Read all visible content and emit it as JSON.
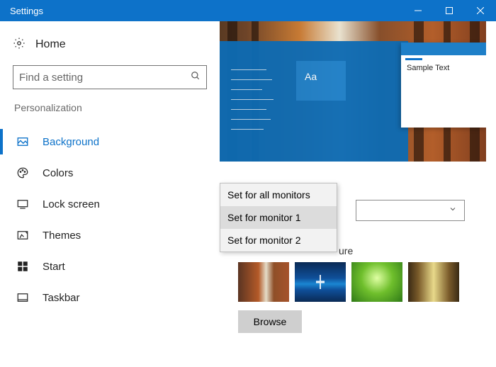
{
  "titlebar": {
    "title": "Settings"
  },
  "sidebar": {
    "home_label": "Home",
    "search_placeholder": "Find a setting",
    "section_label": "Personalization",
    "items": [
      {
        "label": "Background"
      },
      {
        "label": "Colors"
      },
      {
        "label": "Lock screen"
      },
      {
        "label": "Themes"
      },
      {
        "label": "Start"
      },
      {
        "label": "Taskbar"
      }
    ]
  },
  "preview": {
    "aa_label": "Aa",
    "sample_text": "Sample Text"
  },
  "context_menu": {
    "items": [
      {
        "label": "Set for all monitors"
      },
      {
        "label": "Set for monitor 1"
      },
      {
        "label": "Set for monitor 2"
      }
    ]
  },
  "main": {
    "choose_picture_label": "ure",
    "browse_label": "Browse"
  }
}
